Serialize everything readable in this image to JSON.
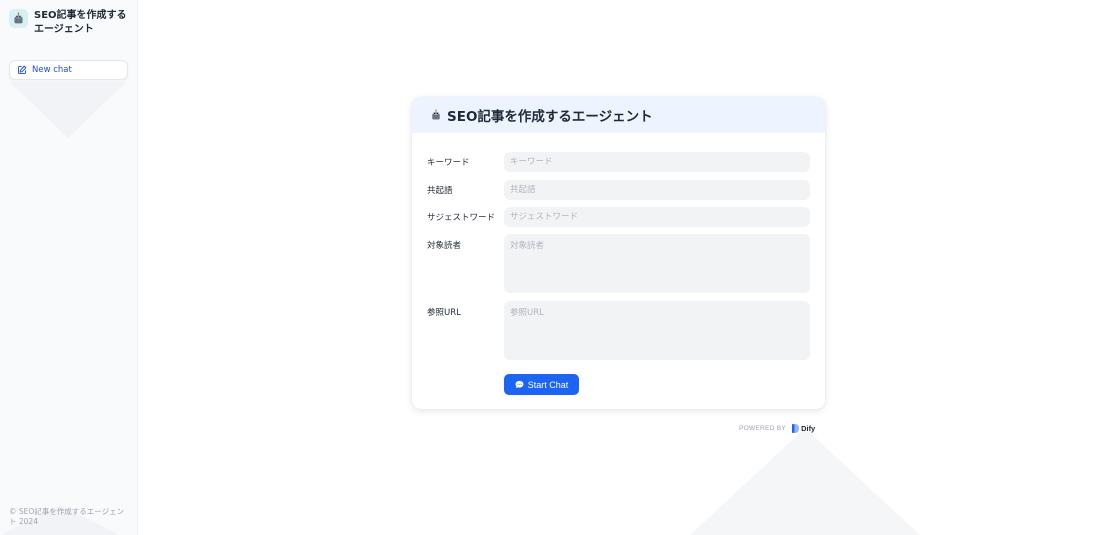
{
  "app": {
    "name": "SEO記事を作成するエージェント",
    "icon": "robot-emoji-icon"
  },
  "sidebar": {
    "new_chat_label": "New chat",
    "copyright": "© SEO記事を作成するエージェント 2024"
  },
  "form": {
    "title": "SEO記事を作成するエージェント",
    "fields": [
      {
        "label": "キーワード",
        "placeholder": "キーワード",
        "value": ""
      },
      {
        "label": "共起語",
        "placeholder": "共起語",
        "value": ""
      },
      {
        "label": "サジェストワード",
        "placeholder": "サジェストワード",
        "value": ""
      },
      {
        "label": "対象読者",
        "placeholder": "対象読者",
        "value": ""
      },
      {
        "label": "参照URL",
        "placeholder": "参照URL",
        "value": ""
      }
    ],
    "start_label": "Start Chat"
  },
  "footer": {
    "powered_by": "POWERED BY",
    "brand": "Dify"
  },
  "colors": {
    "accent": "#1c64f2",
    "header_bg": "#eef4ff",
    "sidebar_bg": "#f9fafb",
    "input_bg": "#f2f3f5"
  }
}
